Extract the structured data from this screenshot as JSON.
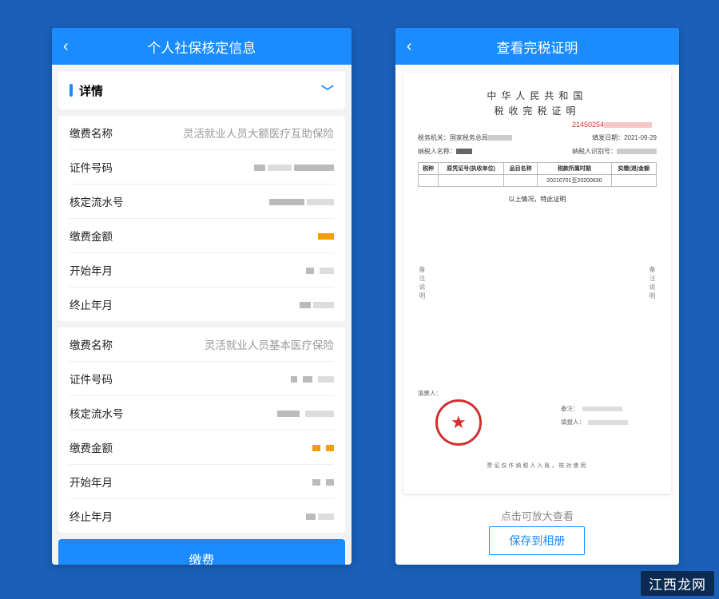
{
  "left": {
    "title": "个人社保核定信息",
    "section": "详情",
    "cards": [
      {
        "rows": [
          {
            "label": "缴费名称",
            "value": "灵活就业人员大额医疗互助保险"
          },
          {
            "label": "证件号码",
            "value": ""
          },
          {
            "label": "核定流水号",
            "value": ""
          },
          {
            "label": "缴费金额",
            "value": ""
          },
          {
            "label": "开始年月",
            "value": ""
          },
          {
            "label": "终止年月",
            "value": ""
          }
        ]
      },
      {
        "rows": [
          {
            "label": "缴费名称",
            "value": "灵活就业人员基本医疗保险"
          },
          {
            "label": "证件号码",
            "value": ""
          },
          {
            "label": "核定流水号",
            "value": ""
          },
          {
            "label": "缴费金额",
            "value": ""
          },
          {
            "label": "开始年月",
            "value": ""
          },
          {
            "label": "终止年月",
            "value": ""
          }
        ]
      }
    ],
    "payButton": "缴费"
  },
  "right": {
    "title": "查看完税证明",
    "doc": {
      "country": "中华人民共和国",
      "docTitle": "税收完税证明",
      "serialPrefix": "21450254",
      "meta": {
        "taxAuthLabel": "税务机关：",
        "taxAuthValue": "国家税务总局",
        "fillDateLabel": "填发日期：",
        "fillDateValue": "2021-09-29",
        "payerLabel": "纳税人名称：",
        "payerIdLabel": "纳税人识别号："
      },
      "tableHeaders": [
        "税种",
        "原凭证号(执收单位)",
        "品目名称",
        "税款所属时期",
        "实缴(退)金额"
      ],
      "tableRow": [
        "",
        "",
        "",
        "20210701至20200630",
        ""
      ],
      "certStatement": "以上情况，特此证明",
      "footLabel": "填票人：",
      "vertNote": "备注说明",
      "sigLabels": [
        "备注：",
        "填报人："
      ],
      "bottomNote": "票证仅作纳税人入账，核对使用"
    },
    "hint": "点击可放大查看",
    "saveButton": "保存到相册"
  },
  "watermark": "江西龙网"
}
